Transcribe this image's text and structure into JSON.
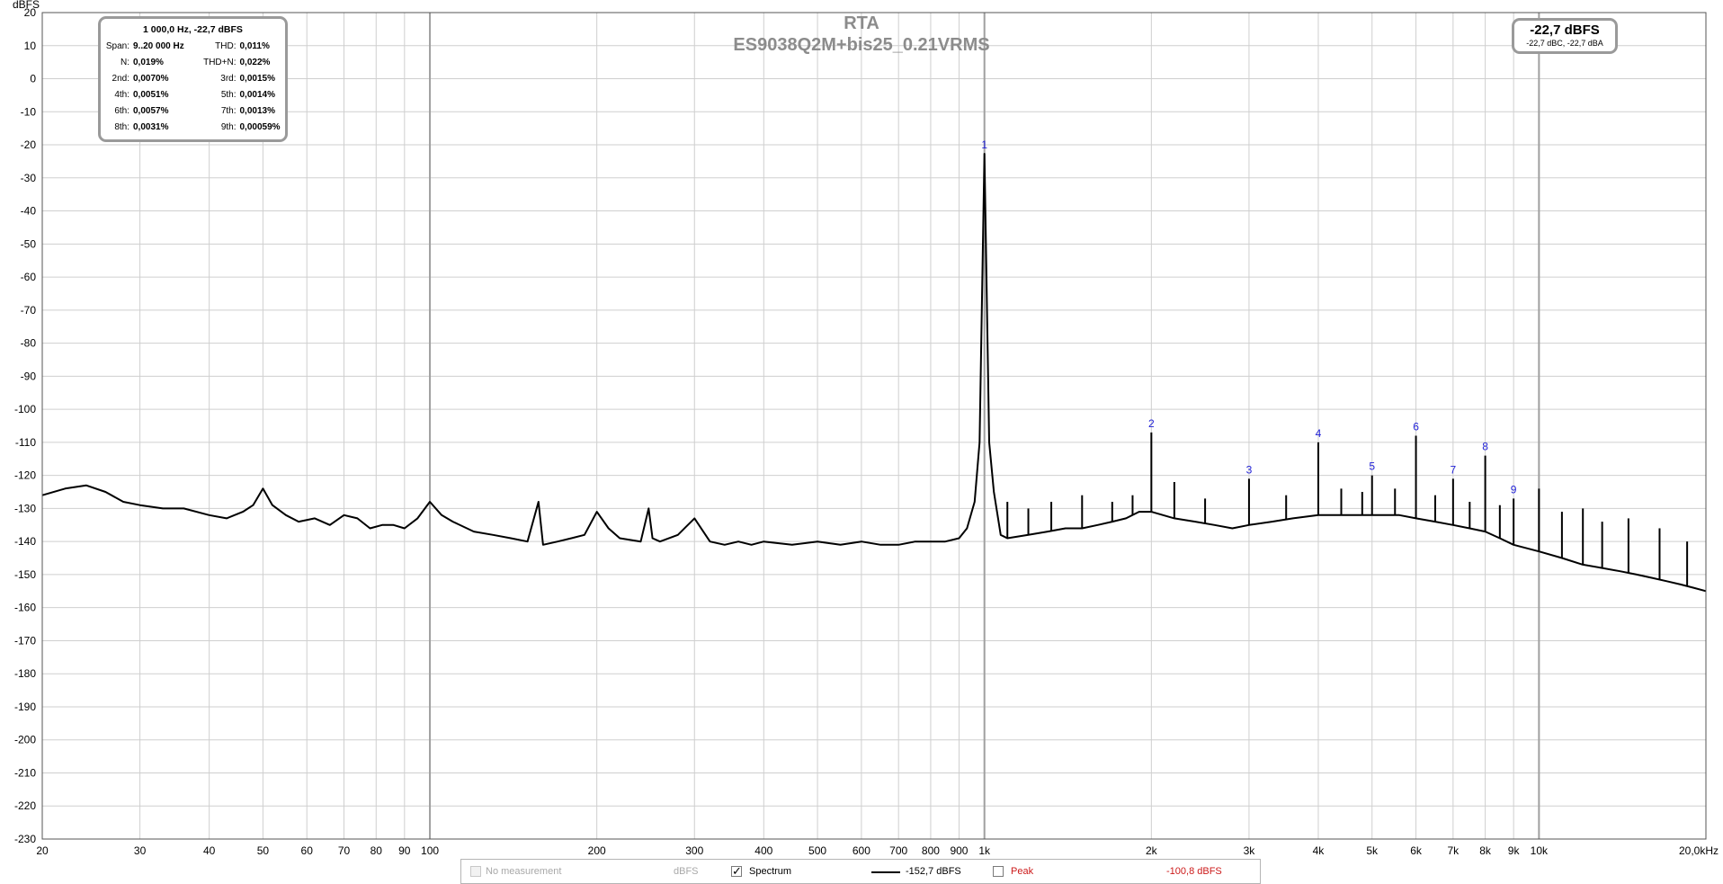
{
  "chart_data": {
    "type": "line",
    "title": "RTA",
    "subtitle": "ES9038Q2M+bis25_0.21VRMS",
    "ylabel": "dBFS",
    "xlabel": "",
    "x_scale": "log",
    "xlim": [
      20,
      20000
    ],
    "ylim": [
      -230,
      20
    ],
    "grid": true,
    "y_ticks": [
      20,
      10,
      0,
      -10,
      -20,
      -30,
      -40,
      -50,
      -60,
      -70,
      -80,
      -90,
      -100,
      -110,
      -120,
      -130,
      -140,
      -150,
      -160,
      -170,
      -180,
      -190,
      -200,
      -210,
      -220,
      -230
    ],
    "x_ticks": [
      {
        "value": 20,
        "label": "20"
      },
      {
        "value": 30,
        "label": "30"
      },
      {
        "value": 40,
        "label": "40"
      },
      {
        "value": 50,
        "label": "50"
      },
      {
        "value": 60,
        "label": "60"
      },
      {
        "value": 70,
        "label": "70"
      },
      {
        "value": 80,
        "label": "80"
      },
      {
        "value": 90,
        "label": "90"
      },
      {
        "value": 100,
        "label": "100"
      },
      {
        "value": 200,
        "label": "200"
      },
      {
        "value": 300,
        "label": "300"
      },
      {
        "value": 400,
        "label": "400"
      },
      {
        "value": 500,
        "label": "500"
      },
      {
        "value": 600,
        "label": "600"
      },
      {
        "value": 700,
        "label": "700"
      },
      {
        "value": 800,
        "label": "800"
      },
      {
        "value": 900,
        "label": "900"
      },
      {
        "value": 1000,
        "label": "1k"
      },
      {
        "value": 2000,
        "label": "2k"
      },
      {
        "value": 3000,
        "label": "3k"
      },
      {
        "value": 4000,
        "label": "4k"
      },
      {
        "value": 5000,
        "label": "5k"
      },
      {
        "value": 6000,
        "label": "6k"
      },
      {
        "value": 7000,
        "label": "7k"
      },
      {
        "value": 8000,
        "label": "8k"
      },
      {
        "value": 9000,
        "label": "9k"
      },
      {
        "value": 10000,
        "label": "10k"
      },
      {
        "value": 20000,
        "label": "20,0kHz"
      }
    ],
    "major_x": [
      100,
      1000,
      10000
    ],
    "series": [
      {
        "name": "Spectrum",
        "color": "#000000",
        "x": [
          20,
          22,
          24,
          26,
          28,
          30,
          33,
          36,
          40,
          43,
          46,
          48,
          50,
          52,
          55,
          58,
          62,
          66,
          70,
          74,
          78,
          82,
          86,
          90,
          95,
          100,
          105,
          110,
          120,
          130,
          140,
          150,
          157,
          160,
          170,
          180,
          190,
          200,
          210,
          220,
          240,
          248,
          252,
          260,
          280,
          300,
          320,
          340,
          360,
          380,
          400,
          450,
          500,
          550,
          600,
          650,
          700,
          750,
          800,
          850,
          900,
          930,
          960,
          980,
          1000,
          1020,
          1040,
          1070,
          1100,
          1200,
          1300,
          1400,
          1500,
          1600,
          1700,
          1800,
          1900,
          2000,
          2200,
          2400,
          2600,
          2800,
          3000,
          3300,
          3600,
          4000,
          4400,
          4800,
          5200,
          5600,
          6000,
          6500,
          7000,
          7500,
          8000,
          8500,
          9000,
          10000,
          11000,
          12000,
          13000,
          14000,
          15000,
          16000,
          17000,
          18000,
          19000,
          20000
        ],
        "y": [
          -126,
          -124,
          -123,
          -125,
          -128,
          -129,
          -130,
          -130,
          -132,
          -133,
          -131,
          -129,
          -124,
          -129,
          -132,
          -134,
          -133,
          -135,
          -132,
          -133,
          -136,
          -135,
          -135,
          -136,
          -133,
          -128,
          -132,
          -134,
          -137,
          -138,
          -139,
          -140,
          -128,
          -141,
          -140,
          -139,
          -138,
          -131,
          -136,
          -139,
          -140,
          -130,
          -139,
          -140,
          -138,
          -133,
          -140,
          -141,
          -140,
          -141,
          -140,
          -141,
          -140,
          -141,
          -140,
          -141,
          -141,
          -140,
          -140,
          -140,
          -139,
          -136,
          -128,
          -110,
          -22.7,
          -110,
          -125,
          -138,
          -139,
          -138,
          -137,
          -136,
          -136,
          -135,
          -134,
          -133,
          -131,
          -131,
          -133,
          -134,
          -135,
          -136,
          -135,
          -134,
          -133,
          -132,
          -132,
          -132,
          -132,
          -132,
          -133,
          -134,
          -135,
          -136,
          -137,
          -139,
          -141,
          -143,
          -145,
          -147,
          -148,
          -149,
          -150,
          -151,
          -152,
          -153,
          -154,
          -155
        ]
      },
      {
        "name": "Peak",
        "color": "#cc1a1a",
        "visible": false
      }
    ],
    "harmonic_markers": [
      {
        "label": "1",
        "x": 1000,
        "y": -22.7
      },
      {
        "label": "2",
        "x": 2000,
        "y": -107
      },
      {
        "label": "3",
        "x": 3000,
        "y": -121
      },
      {
        "label": "4",
        "x": 4000,
        "y": -110
      },
      {
        "label": "5",
        "x": 5000,
        "y": -120
      },
      {
        "label": "6",
        "x": 6000,
        "y": -108
      },
      {
        "label": "7",
        "x": 7000,
        "y": -121
      },
      {
        "label": "8",
        "x": 8000,
        "y": -114
      },
      {
        "label": "9",
        "x": 9000,
        "y": -127
      }
    ],
    "extra_spurs": [
      {
        "x": 1100,
        "y": -128
      },
      {
        "x": 1200,
        "y": -130
      },
      {
        "x": 1320,
        "y": -128
      },
      {
        "x": 1500,
        "y": -126
      },
      {
        "x": 1700,
        "y": -128
      },
      {
        "x": 1850,
        "y": -126
      },
      {
        "x": 2200,
        "y": -122
      },
      {
        "x": 2500,
        "y": -127
      },
      {
        "x": 3500,
        "y": -126
      },
      {
        "x": 4400,
        "y": -124
      },
      {
        "x": 4800,
        "y": -125
      },
      {
        "x": 5500,
        "y": -124
      },
      {
        "x": 6500,
        "y": -126
      },
      {
        "x": 7500,
        "y": -128
      },
      {
        "x": 8500,
        "y": -129
      },
      {
        "x": 10000,
        "y": -124
      },
      {
        "x": 11000,
        "y": -131
      },
      {
        "x": 12000,
        "y": -130
      },
      {
        "x": 13000,
        "y": -134
      },
      {
        "x": 14500,
        "y": -133
      },
      {
        "x": 16500,
        "y": -136
      },
      {
        "x": 18500,
        "y": -140
      }
    ]
  },
  "info_box": {
    "header": "1 000,0 Hz, -22,7 dBFS",
    "rows": [
      {
        "l1": "Span:",
        "v1": "9..20 000 Hz",
        "l2": "THD:",
        "v2": "0,011%"
      },
      {
        "l1": "N:",
        "v1": "0,019%",
        "l2": "THD+N:",
        "v2": "0,022%"
      },
      {
        "l1": "2nd:",
        "v1": "0,0070%",
        "l2": "3rd:",
        "v2": "0,0015%"
      },
      {
        "l1": "4th:",
        "v1": "0,0051%",
        "l2": "5th:",
        "v2": "0,0014%"
      },
      {
        "l1": "6th:",
        "v1": "0,0057%",
        "l2": "7th:",
        "v2": "0,0013%"
      },
      {
        "l1": "8th:",
        "v1": "0,0031%",
        "l2": "9th:",
        "v2": "0,00059%"
      }
    ]
  },
  "level_box": {
    "main": "-22,7 dBFS",
    "sub": "-22,7 dBC, -22,7 dBA"
  },
  "legend": {
    "no_measurement": "No measurement",
    "no_measurement_unit": "dBFS",
    "spectrum_label": "Spectrum",
    "spectrum_checked": true,
    "spectrum_value": "-152,7 dBFS",
    "peak_label": "Peak",
    "peak_checked": false,
    "peak_value": "-100,8 dBFS"
  }
}
